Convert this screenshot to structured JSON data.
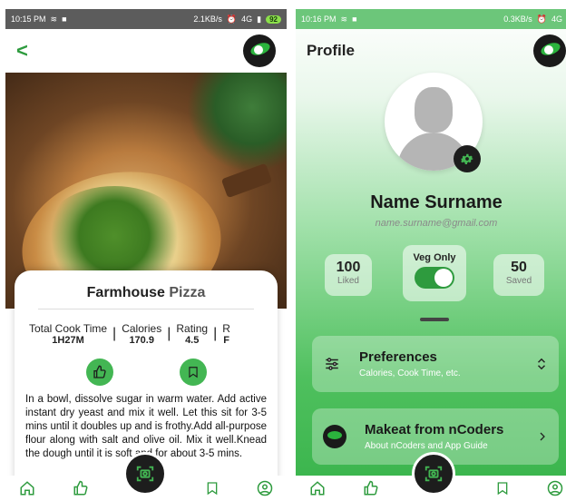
{
  "left_screen": {
    "status": {
      "time": "10:15 PM",
      "speed": "2.1KB/s",
      "network": "4G",
      "battery": "92"
    },
    "recipe": {
      "title_main": "Farmhouse",
      "title_accent": "Pizza",
      "stats": [
        {
          "label": "Total Cook Time",
          "value": "1H27M"
        },
        {
          "label": "Calories",
          "value": "170.9"
        },
        {
          "label": "Rating",
          "value": "4.5"
        },
        {
          "label": "R",
          "value": "F"
        }
      ],
      "text": "In a bowl, dissolve sugar in warm water. Add active instant dry yeast and mix it well. Let this sit for 3-5 mins until it doubles up and is frothy.Add all-purpose flour along with salt and olive oil. Mix it well.Knead the dough until it is soft and for about 3-5 mins."
    },
    "icons": {
      "back": "chevron-left-icon",
      "like": "thumbs-up-icon",
      "save": "bookmark-icon",
      "scan": "camera-scan-icon"
    }
  },
  "right_screen": {
    "status": {
      "time": "10:16 PM",
      "speed": "0.3KB/s",
      "network": "4G"
    },
    "title": "Profile",
    "user": {
      "name": "Name Surname",
      "email": "name.surname@gmail.com"
    },
    "stats": {
      "liked": {
        "value": "100",
        "label": "Liked"
      },
      "saved": {
        "value": "50",
        "label": "Saved"
      },
      "veg_only": {
        "label": "Veg Only",
        "on": true
      }
    },
    "menu": [
      {
        "title": "Preferences",
        "subtitle": "Calories, Cook Time, etc."
      },
      {
        "title": "Makeat from nCoders",
        "subtitle": "About nCoders and App Guide"
      }
    ]
  },
  "colors": {
    "accent": "#43b653",
    "dark": "#1d1d1d"
  }
}
